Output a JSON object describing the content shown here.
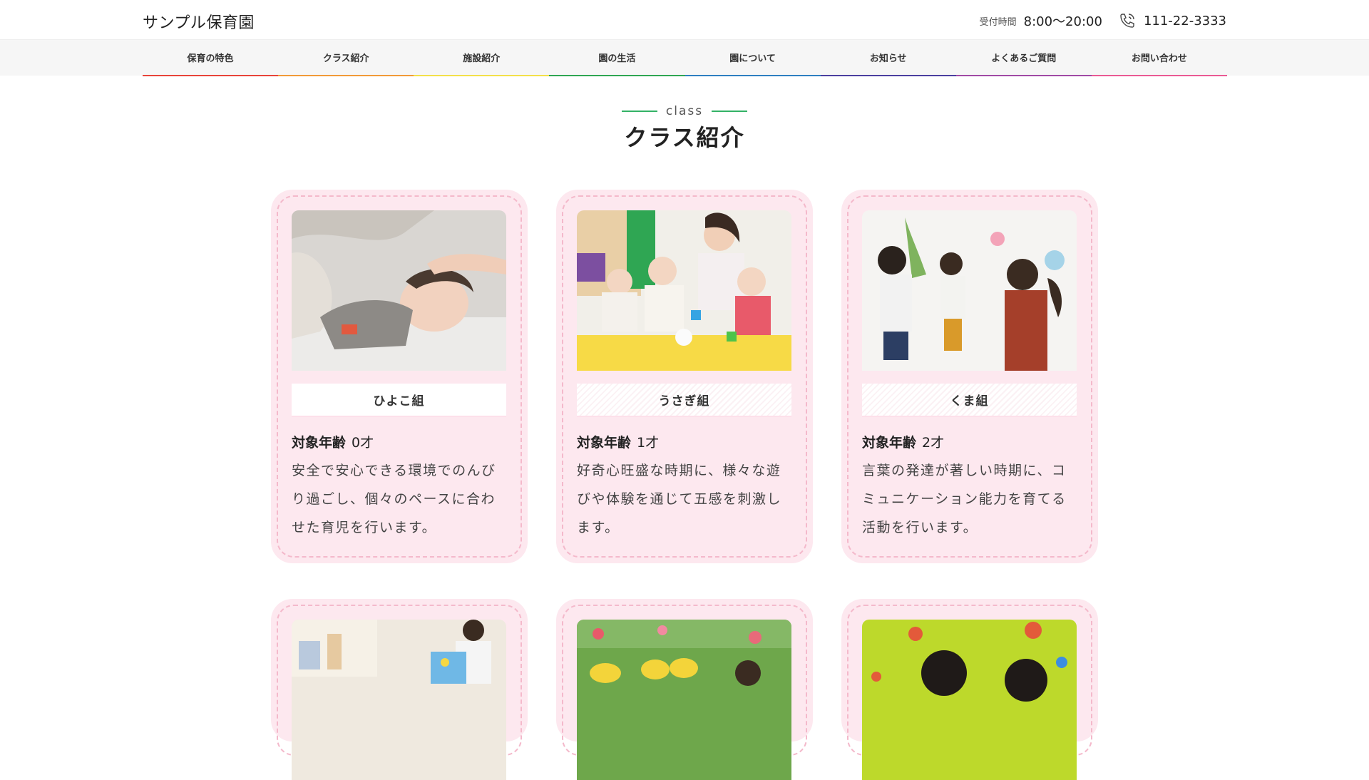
{
  "header": {
    "logo": "サンプル保育園",
    "hours_label": "受付時間",
    "hours": "8:00〜20:00",
    "phone": "111-22-3333"
  },
  "nav": [
    {
      "label": "保育の特色",
      "color": "#e8443a"
    },
    {
      "label": "クラス紹介",
      "color": "#f19a38"
    },
    {
      "label": "施設紹介",
      "color": "#f3e04a"
    },
    {
      "label": "園の生活",
      "color": "#2fa653"
    },
    {
      "label": "園について",
      "color": "#2e7fc1"
    },
    {
      "label": "お知らせ",
      "color": "#4b3fa0"
    },
    {
      "label": "よくあるご質問",
      "color": "#a14aa5"
    },
    {
      "label": "お問い合わせ",
      "color": "#ea5a94"
    }
  ],
  "section": {
    "eyebrow": "class",
    "title": "クラス紹介"
  },
  "age_label": "対象年齢",
  "classes": [
    {
      "name": "ひよこ組",
      "age": "0才",
      "desc": "安全で安心できる環境でのんびり過ごし、個々のペースに合わせた育児を行います。",
      "photo": "sleeping-baby"
    },
    {
      "name": "うさぎ組",
      "age": "1才",
      "desc": "好奇心旺盛な時期に、様々な遊びや体験を通じて五感を刺激します。",
      "photo": "babies-playing"
    },
    {
      "name": "くま組",
      "age": "2才",
      "desc": "言葉の発達が著しい時期に、コミュニケーション能力を育てる活動を行います。",
      "photo": "children-dancing"
    }
  ],
  "colors": {
    "card_bg": "#fde8ef",
    "card_border": "#f4b9cb",
    "accent_green": "#33b266"
  }
}
